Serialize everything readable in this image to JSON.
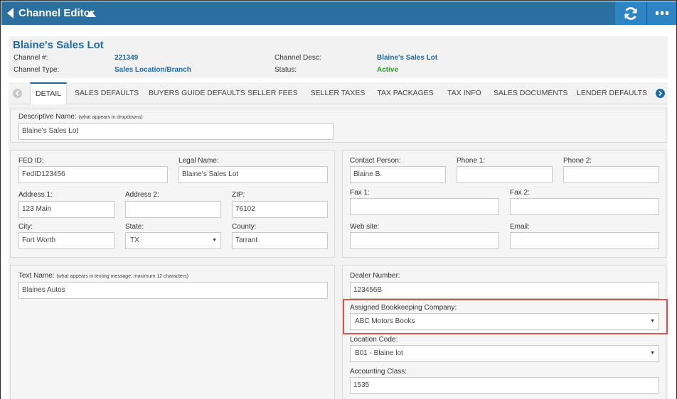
{
  "topbar": {
    "title": "Channel Editor"
  },
  "header": {
    "name": "Blaine's Sales Lot",
    "channel_num_label": "Channel #:",
    "channel_num": "221349",
    "channel_type_label": "Channel Type:",
    "channel_type": "Sales Location/Branch",
    "channel_desc_label": "Channel Desc:",
    "channel_desc": "Blaine's Sales Lot",
    "status_label": "Status:",
    "status": "Active"
  },
  "tabs": [
    "DETAIL",
    "SALES DEFAULTS",
    "BUYERS GUIDE DEFAULTS",
    "SELLER FEES",
    "SELLER TAXES",
    "TAX PACKAGES",
    "TAX INFO",
    "SALES DOCUMENTS",
    "LENDER DEFAULTS"
  ],
  "descriptive": {
    "label": "Descriptive Name:",
    "hint": "(what appears in dropdowns)",
    "value": "Blaine's Sales Lot"
  },
  "left": {
    "fed_id_label": "FED ID:",
    "fed_id": "FedID123456",
    "legal_name_label": "Legal Name:",
    "legal_name": "Blaine's Sales Lot",
    "address1_label": "Address 1:",
    "address1": "123 Main",
    "address2_label": "Address 2:",
    "address2": "",
    "zip_label": "ZIP:",
    "zip": "76102",
    "city_label": "City:",
    "city": "Fort Worth",
    "state_label": "State:",
    "state": "TX",
    "county_label": "County:",
    "county": "Tarrant"
  },
  "contact": {
    "contact_label": "Contact Person:",
    "contact": "Blaine B.",
    "phone1_label": "Phone 1:",
    "phone1": "",
    "phone2_label": "Phone 2:",
    "phone2": "",
    "fax1_label": "Fax 1:",
    "fax1": "",
    "fax2_label": "Fax 2:",
    "fax2": "",
    "website_label": "Web site:",
    "website": "",
    "email_label": "Email:",
    "email": ""
  },
  "text_name": {
    "label": "Text Name:",
    "hint": "(what appears in texting message; maximum 12 characters)",
    "value": "Blaines Autos"
  },
  "dealer": {
    "dealer_number_label": "Dealer Number:",
    "dealer_number": "123456B",
    "bookkeeping_label": "Assigned Bookkeeping Company:",
    "bookkeeping": "ABC Motors Books",
    "location_code_label": "Location Code:",
    "location_code": "B01 - Blaine lot",
    "accounting_class_label": "Accounting Class:",
    "accounting_class": "1535"
  },
  "colors": {
    "topbar": "#296f9f",
    "accent": "#1f6aa5",
    "status_active": "#2e9b2e",
    "highlight": "#d9534f"
  }
}
